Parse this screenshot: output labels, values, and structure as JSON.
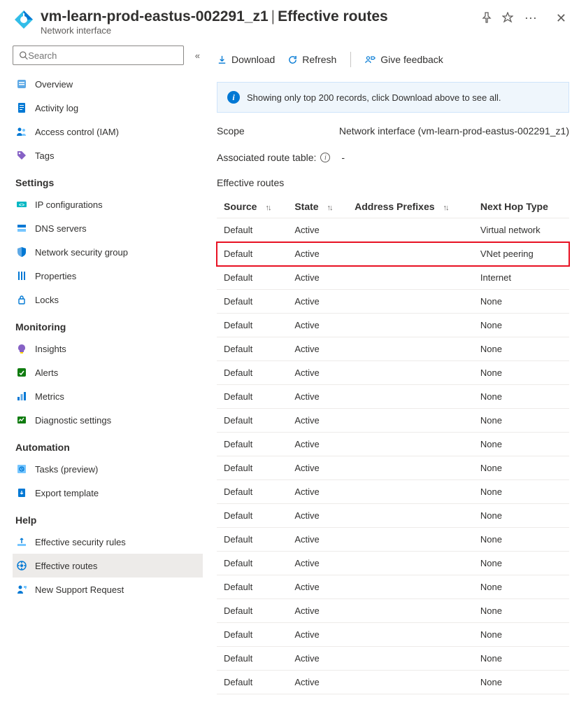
{
  "header": {
    "resource_name": "vm-learn-prod-eastus-002291_z1",
    "separator": " | ",
    "section": "Effective routes",
    "subtitle": "Network interface"
  },
  "search": {
    "placeholder": "Search"
  },
  "sidebar": {
    "top": [
      {
        "label": "Overview",
        "key": "overview"
      },
      {
        "label": "Activity log",
        "key": "activity-log"
      },
      {
        "label": "Access control (IAM)",
        "key": "access-control"
      },
      {
        "label": "Tags",
        "key": "tags"
      }
    ],
    "groups": [
      {
        "heading": "Settings",
        "items": [
          {
            "label": "IP configurations",
            "key": "ip-configurations"
          },
          {
            "label": "DNS servers",
            "key": "dns-servers"
          },
          {
            "label": "Network security group",
            "key": "nsg"
          },
          {
            "label": "Properties",
            "key": "properties"
          },
          {
            "label": "Locks",
            "key": "locks"
          }
        ]
      },
      {
        "heading": "Monitoring",
        "items": [
          {
            "label": "Insights",
            "key": "insights"
          },
          {
            "label": "Alerts",
            "key": "alerts"
          },
          {
            "label": "Metrics",
            "key": "metrics"
          },
          {
            "label": "Diagnostic settings",
            "key": "diagnostic-settings"
          }
        ]
      },
      {
        "heading": "Automation",
        "items": [
          {
            "label": "Tasks (preview)",
            "key": "tasks"
          },
          {
            "label": "Export template",
            "key": "export-template"
          }
        ]
      },
      {
        "heading": "Help",
        "items": [
          {
            "label": "Effective security rules",
            "key": "eff-sec-rules"
          },
          {
            "label": "Effective routes",
            "key": "eff-routes",
            "selected": true
          },
          {
            "label": "New Support Request",
            "key": "support"
          }
        ]
      }
    ]
  },
  "toolbar": {
    "download": "Download",
    "refresh": "Refresh",
    "feedback": "Give feedback"
  },
  "info_bar": "Showing only top 200 records, click Download above to see all.",
  "scope": {
    "label": "Scope",
    "value": "Network interface (vm-learn-prod-eastus-002291_z1)"
  },
  "associated": {
    "label": "Associated route table:",
    "value": "-"
  },
  "section_title": "Effective routes",
  "table": {
    "columns": [
      "Source",
      "State",
      "Address Prefixes",
      "Next Hop Type"
    ],
    "rows": [
      {
        "source": "Default",
        "state": "Active",
        "prefixes": "",
        "next_hop": "Virtual network"
      },
      {
        "source": "Default",
        "state": "Active",
        "prefixes": "",
        "next_hop": "VNet peering",
        "highlight": true
      },
      {
        "source": "Default",
        "state": "Active",
        "prefixes": "",
        "next_hop": "Internet"
      },
      {
        "source": "Default",
        "state": "Active",
        "prefixes": "",
        "next_hop": "None"
      },
      {
        "source": "Default",
        "state": "Active",
        "prefixes": "",
        "next_hop": "None"
      },
      {
        "source": "Default",
        "state": "Active",
        "prefixes": "",
        "next_hop": "None"
      },
      {
        "source": "Default",
        "state": "Active",
        "prefixes": "",
        "next_hop": "None"
      },
      {
        "source": "Default",
        "state": "Active",
        "prefixes": "",
        "next_hop": "None"
      },
      {
        "source": "Default",
        "state": "Active",
        "prefixes": "",
        "next_hop": "None"
      },
      {
        "source": "Default",
        "state": "Active",
        "prefixes": "",
        "next_hop": "None"
      },
      {
        "source": "Default",
        "state": "Active",
        "prefixes": "",
        "next_hop": "None"
      },
      {
        "source": "Default",
        "state": "Active",
        "prefixes": "",
        "next_hop": "None"
      },
      {
        "source": "Default",
        "state": "Active",
        "prefixes": "",
        "next_hop": "None"
      },
      {
        "source": "Default",
        "state": "Active",
        "prefixes": "",
        "next_hop": "None"
      },
      {
        "source": "Default",
        "state": "Active",
        "prefixes": "",
        "next_hop": "None"
      },
      {
        "source": "Default",
        "state": "Active",
        "prefixes": "",
        "next_hop": "None"
      },
      {
        "source": "Default",
        "state": "Active",
        "prefixes": "",
        "next_hop": "None"
      },
      {
        "source": "Default",
        "state": "Active",
        "prefixes": "",
        "next_hop": "None"
      },
      {
        "source": "Default",
        "state": "Active",
        "prefixes": "",
        "next_hop": "None"
      },
      {
        "source": "Default",
        "state": "Active",
        "prefixes": "",
        "next_hop": "None"
      }
    ]
  },
  "icons": {
    "overview": "#0078d4",
    "activity-log": "#0078d4",
    "access-control": "#0078d4",
    "tags": "#8661c5",
    "ip-configurations": "#00b7c3",
    "dns-servers": "#0078d4",
    "nsg": "#0078d4",
    "properties": "#0078d4",
    "locks": "#0078d4",
    "insights": "#8661c5",
    "alerts": "#107c10",
    "metrics": "#0078d4",
    "diagnostic-settings": "#107c10",
    "tasks": "#0078d4",
    "export-template": "#0078d4",
    "eff-sec-rules": "#0078d4",
    "eff-routes": "#0078d4",
    "support": "#0078d4"
  }
}
